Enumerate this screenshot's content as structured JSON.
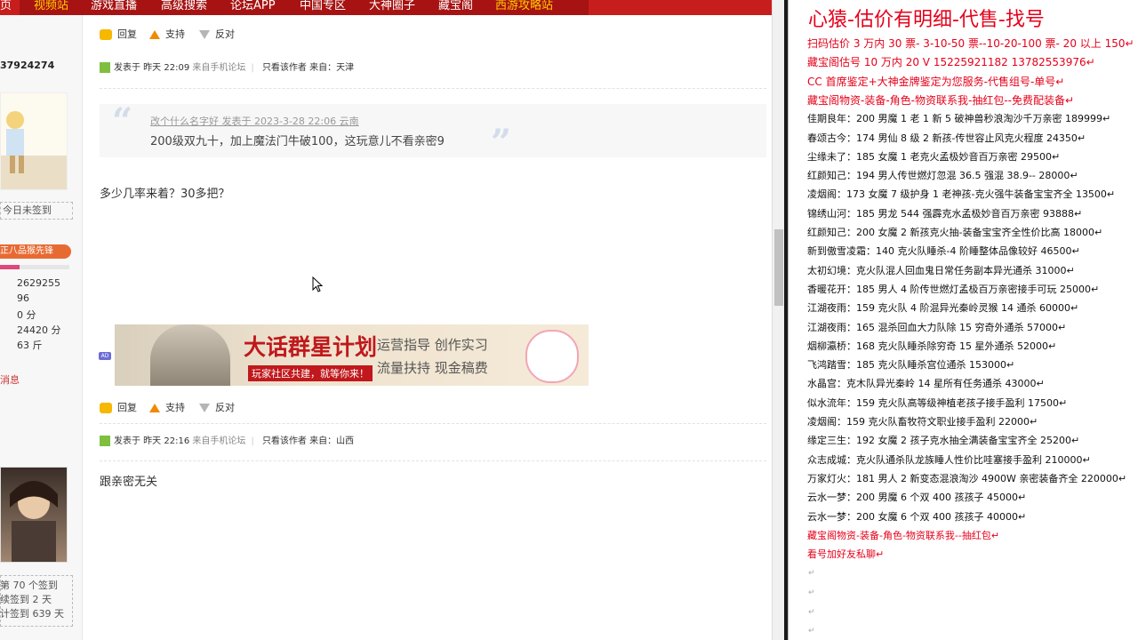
{
  "topnav": {
    "items": [
      "页",
      "视频站",
      "游戏直播",
      "高级搜索",
      "论坛APP",
      "中国专区",
      "大神圈子",
      "藏宝阁",
      "西游攻略站"
    ]
  },
  "sidebar": {
    "uid": "37924274",
    "sign_status": "今日未签到",
    "rank_label": "正八品猴先锋",
    "progress": 0.28,
    "stats": [
      "2629255",
      "96",
      "0 分",
      "24420 分",
      "63 斤"
    ],
    "message_link": "消息",
    "sign_lines": [
      "第 70 个签到",
      "续签到 2 天",
      "计签到 639 天"
    ]
  },
  "actions": {
    "reply": "回复",
    "support": "支持",
    "oppose": "反对"
  },
  "post1_meta": {
    "posted": "发表于 昨天 22:09",
    "source": "来自手机论坛",
    "only_author": "只看该作者",
    "from": "来自：天津"
  },
  "quote": {
    "header": "改个什么名字好 发表于 2023-3-28 22:06 云南",
    "text": "200级双九十，加上魔法门牛破100，这玩意儿不看亲密9"
  },
  "post1_text": "多少几率来着？30多把？",
  "banner": {
    "title": "大话群星计划",
    "subtitle": "玩家社区共建，就等你来！",
    "line1": "运营指导  创作实习",
    "line2": "流量扶持  现金稿费",
    "badge": "AD"
  },
  "post2_meta": {
    "posted": "发表于 昨天 22:16",
    "source": "来自手机论坛",
    "only_author": "只看该作者",
    "from": "来自：山西"
  },
  "post2_text": "跟亲密无关",
  "right_panel": {
    "title": "心猿-估价有明细-代售-找号",
    "lines": [
      {
        "text": "扫码估价 3 万内 30 票- 3-10-50 票--10-20-100 票- 20 以上 150↵",
        "red": true
      },
      {
        "text": "藏宝阁估号 10 万内 20 V 15225921182   13782553976↵",
        "red": true
      },
      {
        "text": "CC 首席鉴定+大神金牌鉴定为您服务-代售组号-单号↵",
        "red": true
      },
      {
        "text": "藏宝阁物资-装备-角色-物资联系我-抽红包--免费配装备↵",
        "red": true
      },
      {
        "text": "佳期良年：200 男魔 1 老 1 新 5 破神兽秒浪淘沙千万亲密 189999↵",
        "red": false
      },
      {
        "text": "春颂古今：174 男仙 8 级 2 新孩-传世容止风克火程度 24350↵",
        "red": false
      },
      {
        "text": "尘缘未了：185 女魔 1 老克火孟极妙音百万亲密 29500↵",
        "red": false
      },
      {
        "text": "红颜知己：194 男人传世燃灯忽混 36.5 强混 38.9-- 28000↵",
        "red": false
      },
      {
        "text": "凌烟阁：173 女魔 7 级护身 1 老神孩-克火强牛装备宝宝齐全 13500↵",
        "red": false
      },
      {
        "text": "锦绣山河：185 男龙 544 强霹克水孟极妙音百万亲密 93888↵",
        "red": false
      },
      {
        "text": "红颜知己：200 女魔 2 新孩克火抽-装备宝宝齐全性价比高 18000↵",
        "red": false
      },
      {
        "text": "新到傲雪凌霜：140 克火队睡杀-4 阶睡整体品像较好 46500↵",
        "red": false
      },
      {
        "text": "太初幻境：克火队混人回血鬼日常任务副本异光通杀 31000↵",
        "red": false
      },
      {
        "text": "香暖花开：185 男人 4 阶传世燃灯孟极百万亲密接手可玩 25000↵",
        "red": false
      },
      {
        "text": "江湖夜雨：159 克火队 4 阶混异光秦岭灵猴 14 通杀 60000↵",
        "red": false
      },
      {
        "text": "江湖夜雨：165 混杀回血大力队除 15 穷奇外通杀 57000↵",
        "red": false
      },
      {
        "text": "烟柳瀛桥：168 克火队睡杀除穷奇 15 星外通杀 52000↵",
        "red": false
      },
      {
        "text": "飞鸿踏雪：185 克火队睡杀宫位通杀 153000↵",
        "red": false
      },
      {
        "text": "水晶宫：克木队异光秦岭 14 星所有任务通杀 43000↵",
        "red": false
      },
      {
        "text": "似水流年：159 克火队高等级神植老孩子接手盈利 17500↵",
        "red": false
      },
      {
        "text": "凌烟阁：159 克火队畜牧符文职业接手盈利 22000↵",
        "red": false
      },
      {
        "text": "缘定三生：192 女魔 2 孩子克水抽全满装备宝宝齐全 25200↵",
        "red": false
      },
      {
        "text": "众志成城：克火队通杀队龙族睡人性价比哇塞接手盈利 210000↵",
        "red": false
      },
      {
        "text": "万家灯火：181 男人 2 新变态混浪淘沙 4900W 亲密装备齐全 220000↵",
        "red": false
      },
      {
        "text": "云水一梦：200 男魔 6 个双 400 孩孩子 45000↵",
        "red": false
      },
      {
        "text": "云水一梦：200 女魔 6 个双 400 孩孩子 40000↵",
        "red": false
      },
      {
        "text": "藏宝阁物资-装备-角色-物资联系我--抽红包↵",
        "red": true
      },
      {
        "text": "看号加好友私聊↵",
        "red": true
      }
    ]
  }
}
